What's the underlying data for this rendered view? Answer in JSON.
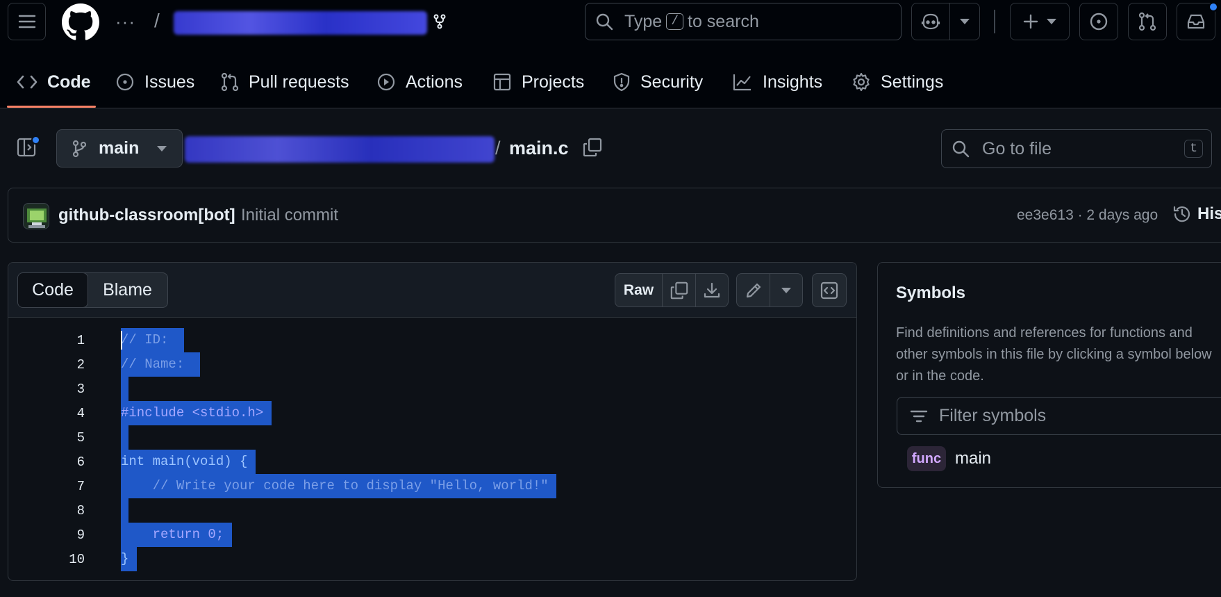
{
  "header": {
    "breadcrumb_dots": "···",
    "breadcrumb_sep": "/",
    "search": {
      "prefix": "Type",
      "key": "/",
      "suffix": "to search"
    }
  },
  "repo_nav": {
    "tabs": [
      {
        "label": "Code",
        "icon": "code-icon"
      },
      {
        "label": "Issues",
        "icon": "issue-opened-icon"
      },
      {
        "label": "Pull requests",
        "icon": "git-pull-request-icon"
      },
      {
        "label": "Actions",
        "icon": "play-icon"
      },
      {
        "label": "Projects",
        "icon": "table-icon"
      },
      {
        "label": "Security",
        "icon": "shield-icon"
      },
      {
        "label": "Insights",
        "icon": "graph-icon"
      },
      {
        "label": "Settings",
        "icon": "gear-icon"
      }
    ],
    "active": "Code"
  },
  "file_header": {
    "branch": "main",
    "path_sep": "/",
    "filename": "main.c",
    "goto_placeholder": "Go to file",
    "goto_key": "t"
  },
  "commit": {
    "author": "github-classroom[bot]",
    "message": "Initial commit",
    "sha_time": "ee3e613 · 2 days ago",
    "history_label": "Hist"
  },
  "code_view": {
    "tabs": [
      "Code",
      "Blame"
    ],
    "active_tab": "Code",
    "raw_label": "Raw",
    "lines": [
      {
        "n": "1",
        "text": "// ID:  "
      },
      {
        "n": "2",
        "text": "// Name:  "
      },
      {
        "n": "3",
        "text": " "
      },
      {
        "n": "4",
        "text": "#include <stdio.h> "
      },
      {
        "n": "5",
        "text": " "
      },
      {
        "n": "6",
        "text": "int main(void) { "
      },
      {
        "n": "7",
        "text": "    // Write your code here to display \"Hello, world!\" "
      },
      {
        "n": "8",
        "text": " "
      },
      {
        "n": "9",
        "text": "    return 0; "
      },
      {
        "n": "10",
        "text": "} "
      }
    ]
  },
  "symbols": {
    "title": "Symbols",
    "description_lines": [
      "Find definitions and references for functions and",
      "other symbols in this file by clicking a symbol below",
      "or in the code."
    ],
    "filter_placeholder": "Filter symbols",
    "items": [
      {
        "kind": "func",
        "name": "main"
      }
    ]
  },
  "colors": {
    "background": "#0d1117",
    "header": "#010409",
    "border": "#30363d",
    "selection": "#1f58c8",
    "accent_underline": "#f78166",
    "func_badge": "#d2a8ff"
  }
}
